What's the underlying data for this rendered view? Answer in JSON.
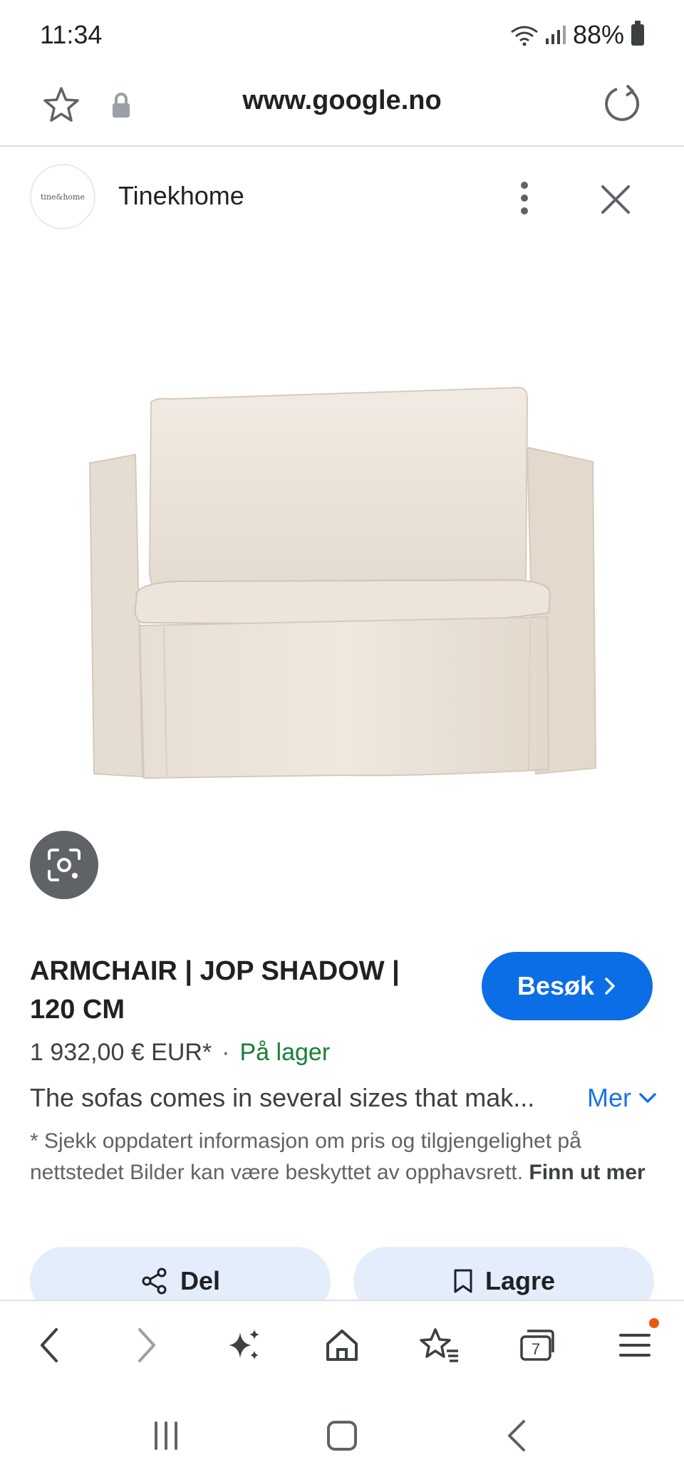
{
  "status_bar": {
    "time": "11:34",
    "battery_percent": "88%",
    "icons": [
      "wifi-icon",
      "signal-icon",
      "battery-icon"
    ]
  },
  "url_bar": {
    "url": "www.google.no",
    "icons": [
      "star-icon",
      "lock-icon",
      "reload-icon"
    ]
  },
  "source": {
    "avatar_text": "tine&home",
    "name": "Tinekhome"
  },
  "product": {
    "title": "ARMCHAIR | JOP SHADOW | 120 CM",
    "visit_label": "Besøk",
    "price": "1 932,00 € EUR*",
    "separator": "·",
    "stock": "På lager",
    "description": "The sofas comes in several sizes that mak...",
    "more_label": "Mer",
    "disclaimer_text": "* Sjekk oppdatert informasjon om pris og tilgjengelighet på nettstedet Bilder kan være beskyttet av opphavsrett.",
    "disclaimer_link": "Finn ut mer"
  },
  "actions": {
    "share_label": "Del",
    "save_label": "Lagre"
  },
  "toolbar": {
    "tab_count": "7",
    "icons": [
      "back-icon",
      "forward-icon",
      "ai-sparkle-icon",
      "home-icon",
      "bookmarks-icon",
      "tabs-icon",
      "menu-icon"
    ]
  },
  "colors": {
    "accent": "#0b6ee6",
    "link": "#1a73e8",
    "stock_green": "#188038",
    "chip_bg": "#e3edfb",
    "notification": "#e8590c"
  }
}
